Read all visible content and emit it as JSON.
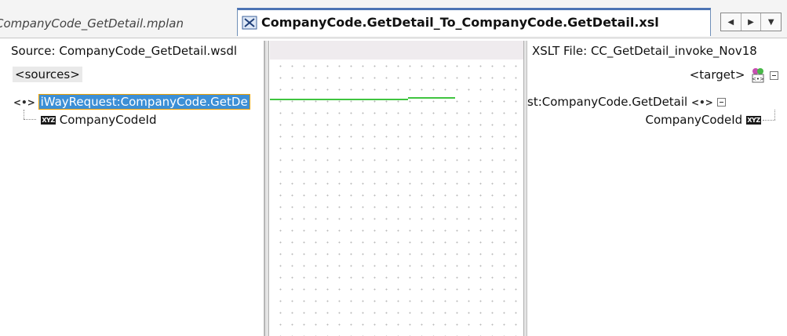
{
  "tabs": {
    "inactive_label": "CompanyCode_GetDetail.mplan",
    "active_label": "CompanyCode.GetDetail_To_CompanyCode.GetDetail.xsl",
    "nav": [
      "◀",
      "▶",
      "▼"
    ]
  },
  "source": {
    "title": "Source: CompanyCode_GetDetail.wsdl",
    "root": "<sources>",
    "element_icon": "<•>",
    "request_node": "iWayRequest:CompanyCode.GetDe",
    "field_icon": "XYZ",
    "field": "CompanyCodeId"
  },
  "target": {
    "title": "XSLT File: CC_GetDetail_invoke_Nov18",
    "root": "<target>",
    "element_icon": "<•>",
    "request_node": "st:CompanyCode.GetDetail",
    "field_icon": "XYZ",
    "field": "CompanyCodeId"
  },
  "colors": {
    "selection": "#3c8fd6",
    "mapping_line": "#3fc43f",
    "active_tab_border": "#4d74b4"
  }
}
